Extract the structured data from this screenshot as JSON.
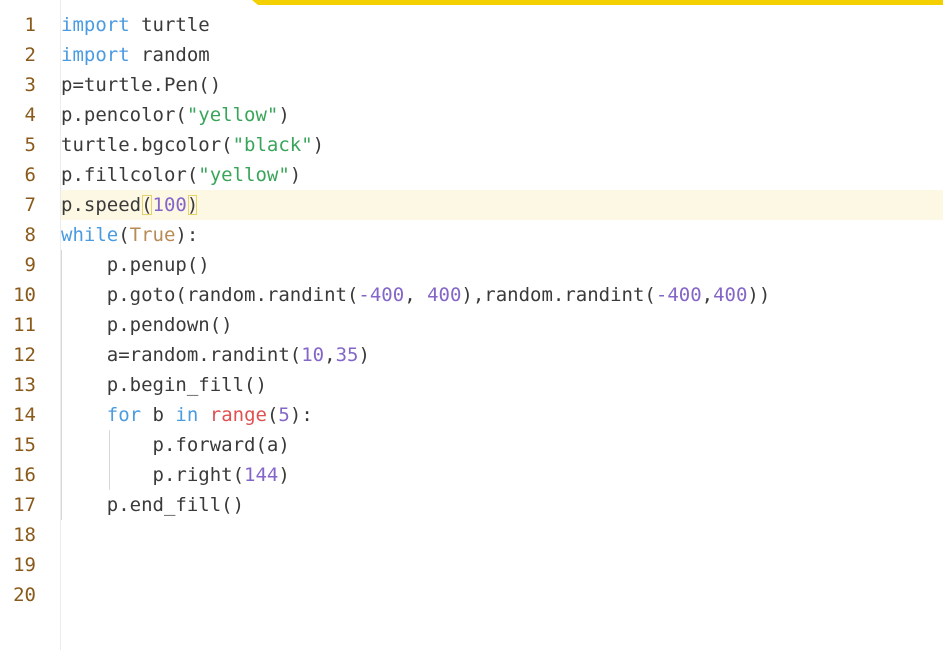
{
  "editor": {
    "accent_color": "#f5d000",
    "active_line": 7,
    "gutter": [
      "1",
      "2",
      "3",
      "4",
      "5",
      "6",
      "7",
      "8",
      "9",
      "10",
      "11",
      "12",
      "13",
      "14",
      "15",
      "16",
      "17",
      "18",
      "19",
      "20"
    ],
    "lines": [
      [
        {
          "t": "import",
          "c": "kw"
        },
        {
          "t": " turtle"
        }
      ],
      [
        {
          "t": "import",
          "c": "kw"
        },
        {
          "t": " random"
        }
      ],
      [
        {
          "t": "p=turtle.Pen()"
        }
      ],
      [
        {
          "t": "p.pencolor("
        },
        {
          "t": "\"yellow\"",
          "c": "str"
        },
        {
          "t": ")"
        }
      ],
      [
        {
          "t": "turtle.bgcolor("
        },
        {
          "t": "\"black\"",
          "c": "str"
        },
        {
          "t": ")"
        }
      ],
      [
        {
          "t": "p.fillcolor("
        },
        {
          "t": "\"yellow\"",
          "c": "str"
        },
        {
          "t": ")"
        }
      ],
      [
        {
          "t": "p.speed"
        },
        {
          "t": "(",
          "c": "brk"
        },
        {
          "t": "100",
          "c": "num"
        },
        {
          "t": ")",
          "c": "brk"
        }
      ],
      [
        {
          "t": "while",
          "c": "kw"
        },
        {
          "t": "("
        },
        {
          "t": "True",
          "c": "bool"
        },
        {
          "t": "):"
        }
      ],
      [
        {
          "t": "    p.penup()"
        }
      ],
      [
        {
          "t": "    p.goto(random.randint("
        },
        {
          "t": "-400",
          "c": "num"
        },
        {
          "t": ", "
        },
        {
          "t": "400",
          "c": "num"
        },
        {
          "t": "),random.randint("
        },
        {
          "t": "-400",
          "c": "num"
        },
        {
          "t": ","
        },
        {
          "t": "400",
          "c": "num"
        },
        {
          "t": "))"
        }
      ],
      [
        {
          "t": "    p.pendown()"
        }
      ],
      [
        {
          "t": "    a=random.randint("
        },
        {
          "t": "10",
          "c": "num"
        },
        {
          "t": ","
        },
        {
          "t": "35",
          "c": "num"
        },
        {
          "t": ")"
        }
      ],
      [
        {
          "t": "    p.begin_fill()"
        }
      ],
      [
        {
          "t": "    "
        },
        {
          "t": "for",
          "c": "kw"
        },
        {
          "t": " b "
        },
        {
          "t": "in",
          "c": "kw"
        },
        {
          "t": " "
        },
        {
          "t": "range",
          "c": "bi"
        },
        {
          "t": "("
        },
        {
          "t": "5",
          "c": "num"
        },
        {
          "t": "):"
        }
      ],
      [
        {
          "t": "        p.forward(a)"
        }
      ],
      [
        {
          "t": "        p.right("
        },
        {
          "t": "144",
          "c": "num"
        },
        {
          "t": ")"
        }
      ],
      [
        {
          "t": "    p.end_fill()"
        }
      ],
      [
        {
          "t": ""
        }
      ],
      [
        {
          "t": ""
        }
      ],
      [
        {
          "t": ""
        }
      ]
    ]
  }
}
